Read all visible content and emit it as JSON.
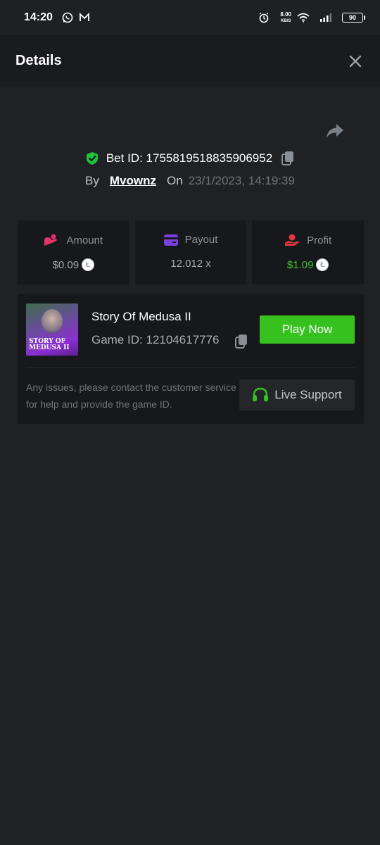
{
  "status_bar": {
    "time": "14:20",
    "speed_value": "8.00",
    "speed_unit": "KB/S",
    "battery": "90"
  },
  "header": {
    "title": "Details"
  },
  "bet": {
    "id_label": "Bet ID:",
    "id_value": "1755819518835906952",
    "by_label": "By",
    "username": "Mvownz",
    "on_label": "On",
    "date": "23/1/2023, 14:19:39"
  },
  "stats": {
    "amount_label": "Amount",
    "amount_value": "$0.09",
    "payout_label": "Payout",
    "payout_value": "12.012 x",
    "profit_label": "Profit",
    "profit_value": "$1.09"
  },
  "game": {
    "thumbnail_text_line1": "STORY OF",
    "thumbnail_text_line2": "MEDUSA II",
    "name": "Story Of Medusa II",
    "id_label": "Game ID:",
    "id_value": "12104617776",
    "play_label": "Play Now",
    "help_text": "Any issues, please contact the customer service for help and provide the game ID.",
    "support_label": "Live Support"
  },
  "colors": {
    "background": "#202124",
    "header_bg": "#1a1b1e",
    "card_bg": "#17181b",
    "accent_green": "#36c11f",
    "profit_green": "#3fc02a",
    "shield_green": "#1fc23b",
    "amount_icon": "#e0336a",
    "payout_icon": "#7b3fe4",
    "profit_icon": "#e2383b"
  },
  "icons": {
    "close": "close-icon",
    "share": "share-icon",
    "shield": "shield-check-icon",
    "copy": "copy-icon",
    "amount": "coins-icon",
    "payout": "card-icon",
    "profit": "hand-coin-icon",
    "coin": "litecoin-icon",
    "support": "headset-icon"
  }
}
